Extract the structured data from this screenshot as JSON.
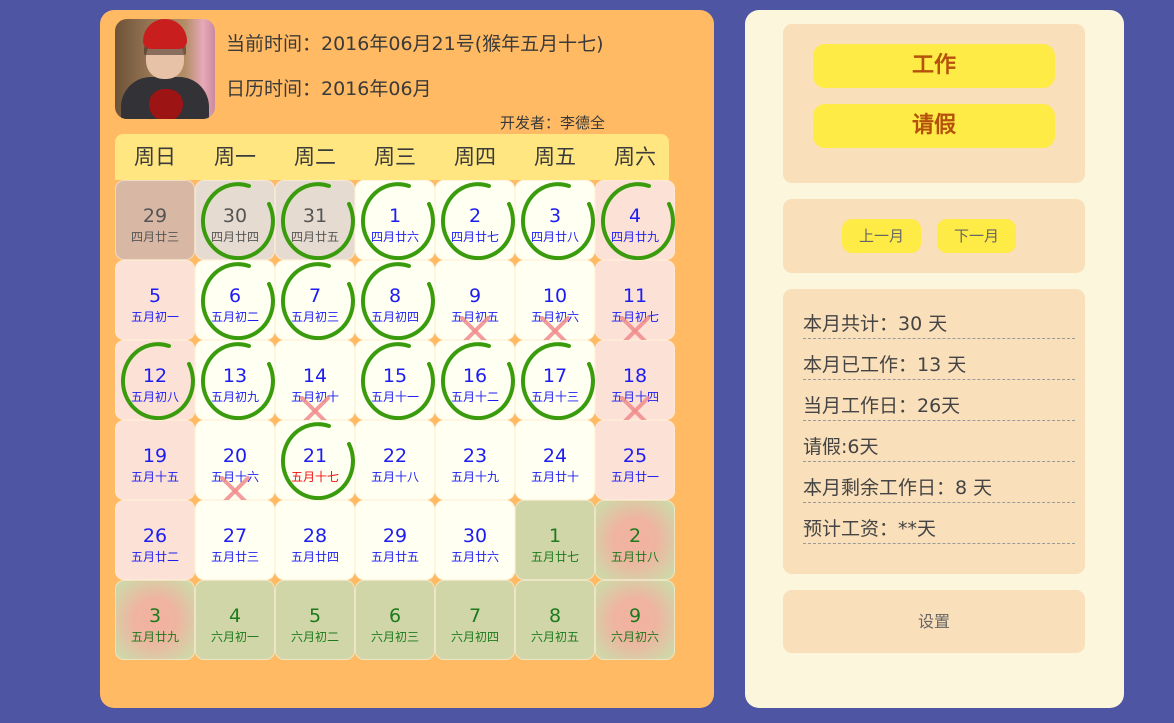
{
  "header": {
    "current_time": "当前时间：2016年06月21号(猴年五月十七)",
    "calendar_time": "日历时间：2016年06月",
    "developer": "开发者：李德全"
  },
  "calendar": {
    "weekdays": [
      "周日",
      "周一",
      "周二",
      "周三",
      "周四",
      "周五",
      "周六"
    ],
    "days": [
      {
        "day": 29,
        "lunar": "四月廿三",
        "month": "prev",
        "weekend": true,
        "mark": "none"
      },
      {
        "day": 30,
        "lunar": "四月廿四",
        "month": "prev",
        "weekend": false,
        "mark": "work"
      },
      {
        "day": 31,
        "lunar": "四月廿五",
        "month": "prev",
        "weekend": false,
        "mark": "work"
      },
      {
        "day": 1,
        "lunar": "四月廿六",
        "month": "current",
        "weekend": false,
        "mark": "work"
      },
      {
        "day": 2,
        "lunar": "四月廿七",
        "month": "current",
        "weekend": false,
        "mark": "work"
      },
      {
        "day": 3,
        "lunar": "四月廿八",
        "month": "current",
        "weekend": false,
        "mark": "work"
      },
      {
        "day": 4,
        "lunar": "四月廿九",
        "month": "current",
        "weekend": true,
        "mark": "work"
      },
      {
        "day": 5,
        "lunar": "五月初一",
        "month": "current",
        "weekend": true,
        "mark": "none"
      },
      {
        "day": 6,
        "lunar": "五月初二",
        "month": "current",
        "weekend": false,
        "mark": "work"
      },
      {
        "day": 7,
        "lunar": "五月初三",
        "month": "current",
        "weekend": false,
        "mark": "work"
      },
      {
        "day": 8,
        "lunar": "五月初四",
        "month": "current",
        "weekend": false,
        "mark": "work"
      },
      {
        "day": 9,
        "lunar": "五月初五",
        "month": "current",
        "weekend": false,
        "mark": "leave"
      },
      {
        "day": 10,
        "lunar": "五月初六",
        "month": "current",
        "weekend": false,
        "mark": "leave"
      },
      {
        "day": 11,
        "lunar": "五月初七",
        "month": "current",
        "weekend": true,
        "mark": "leave"
      },
      {
        "day": 12,
        "lunar": "五月初八",
        "month": "current",
        "weekend": true,
        "mark": "work"
      },
      {
        "day": 13,
        "lunar": "五月初九",
        "month": "current",
        "weekend": false,
        "mark": "work"
      },
      {
        "day": 14,
        "lunar": "五月初十",
        "month": "current",
        "weekend": false,
        "mark": "leave"
      },
      {
        "day": 15,
        "lunar": "五月十一",
        "month": "current",
        "weekend": false,
        "mark": "work"
      },
      {
        "day": 16,
        "lunar": "五月十二",
        "month": "current",
        "weekend": false,
        "mark": "work"
      },
      {
        "day": 17,
        "lunar": "五月十三",
        "month": "current",
        "weekend": false,
        "mark": "work"
      },
      {
        "day": 18,
        "lunar": "五月十四",
        "month": "current",
        "weekend": true,
        "mark": "leave"
      },
      {
        "day": 19,
        "lunar": "五月十五",
        "month": "current",
        "weekend": true,
        "mark": "none"
      },
      {
        "day": 20,
        "lunar": "五月十六",
        "month": "current",
        "weekend": false,
        "mark": "leave"
      },
      {
        "day": 21,
        "lunar": "五月十七",
        "month": "current",
        "weekend": false,
        "mark": "work",
        "today": true
      },
      {
        "day": 22,
        "lunar": "五月十八",
        "month": "current",
        "weekend": false,
        "mark": "none"
      },
      {
        "day": 23,
        "lunar": "五月十九",
        "month": "current",
        "weekend": false,
        "mark": "none"
      },
      {
        "day": 24,
        "lunar": "五月廿十",
        "month": "current",
        "weekend": false,
        "mark": "none"
      },
      {
        "day": 25,
        "lunar": "五月廿一",
        "month": "current",
        "weekend": true,
        "mark": "none"
      },
      {
        "day": 26,
        "lunar": "五月廿二",
        "month": "current",
        "weekend": true,
        "mark": "none"
      },
      {
        "day": 27,
        "lunar": "五月廿三",
        "month": "current",
        "weekend": false,
        "mark": "none"
      },
      {
        "day": 28,
        "lunar": "五月廿四",
        "month": "current",
        "weekend": false,
        "mark": "none"
      },
      {
        "day": 29,
        "lunar": "五月廿五",
        "month": "current",
        "weekend": false,
        "mark": "none"
      },
      {
        "day": 30,
        "lunar": "五月廿六",
        "month": "current",
        "weekend": false,
        "mark": "none"
      },
      {
        "day": 1,
        "lunar": "五月廿七",
        "month": "next",
        "weekend": false,
        "mark": "none"
      },
      {
        "day": 2,
        "lunar": "五月廿八",
        "month": "next",
        "weekend": true,
        "mark": "none"
      },
      {
        "day": 3,
        "lunar": "五月廿九",
        "month": "next",
        "weekend": true,
        "mark": "none"
      },
      {
        "day": 4,
        "lunar": "六月初一",
        "month": "next",
        "weekend": false,
        "mark": "none"
      },
      {
        "day": 5,
        "lunar": "六月初二",
        "month": "next",
        "weekend": false,
        "mark": "none"
      },
      {
        "day": 6,
        "lunar": "六月初三",
        "month": "next",
        "weekend": false,
        "mark": "none"
      },
      {
        "day": 7,
        "lunar": "六月初四",
        "month": "next",
        "weekend": false,
        "mark": "none"
      },
      {
        "day": 8,
        "lunar": "六月初五",
        "month": "next",
        "weekend": false,
        "mark": "none"
      },
      {
        "day": 9,
        "lunar": "六月初六",
        "month": "next",
        "weekend": true,
        "mark": "none"
      }
    ]
  },
  "actions": {
    "work_label": "工作",
    "leave_label": "请假"
  },
  "nav": {
    "prev_label": "上一月",
    "next_label": "下一月"
  },
  "stats": [
    "本月共计：30 天",
    "本月已工作：13 天",
    "当月工作日：26天",
    "请假:6天",
    "本月剩余工作日：8 天",
    "预计工资：**天"
  ],
  "settings_label": "设置",
  "icons": {
    "work_mark": "green-circle-icon",
    "leave_mark": "red-cross-icon"
  },
  "colors": {
    "background": "#4E55A3",
    "left_panel": "#FFBA63",
    "right_panel": "#FCF6DC",
    "button_yellow": "#FFEB45",
    "work_circle": "#3A9C0C",
    "leave_cross": "#F08C8C",
    "current_text": "#1D1DF2",
    "next_text": "#1D7A1D",
    "today_lunar": "#F01010"
  }
}
